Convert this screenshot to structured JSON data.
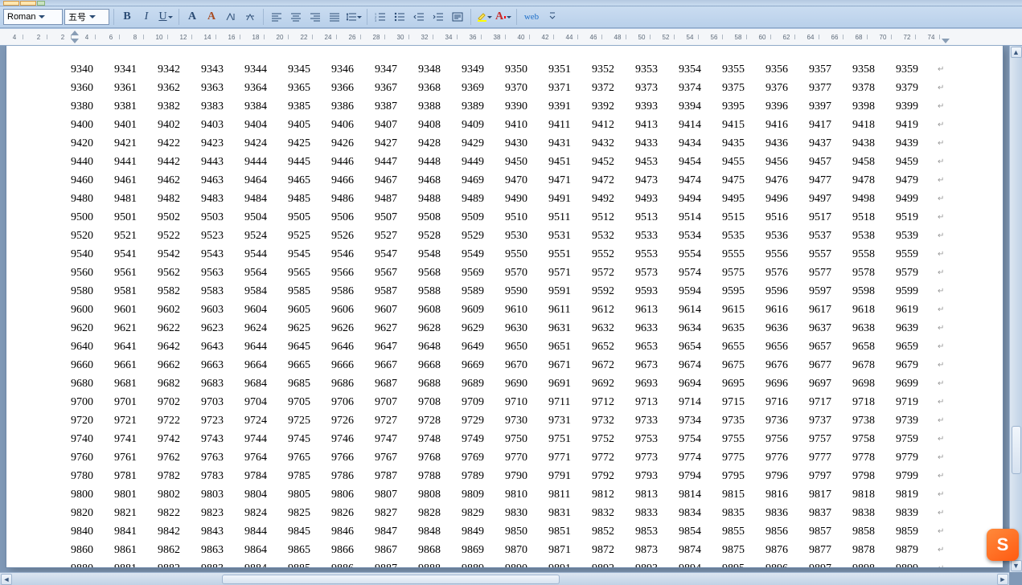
{
  "toolbar": {
    "font_name": "Roman",
    "font_size": "五号",
    "bold_label": "B",
    "italic_label": "I",
    "underline_label": "U"
  },
  "ruler": {
    "labels": [
      "4",
      "2",
      "2",
      "4",
      "6",
      "8",
      "10",
      "12",
      "14",
      "16",
      "18",
      "20",
      "22",
      "24",
      "26",
      "28",
      "30",
      "32",
      "34",
      "36",
      "38",
      "40",
      "42",
      "44",
      "46",
      "48",
      "50",
      "52",
      "54",
      "56",
      "58",
      "60",
      "62",
      "64",
      "66",
      "68",
      "70",
      "72",
      "74"
    ]
  },
  "document": {
    "start": 9340,
    "cols": 20,
    "rows": 28,
    "paragraph_mark": "↵"
  },
  "ime": {
    "label": "S"
  }
}
